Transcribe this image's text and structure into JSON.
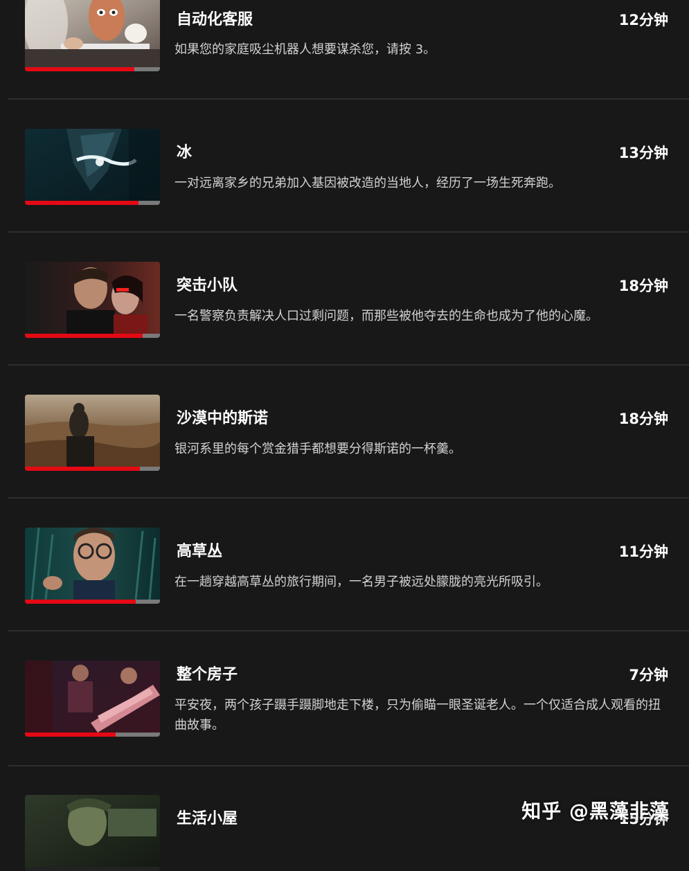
{
  "colors": {
    "background": "#181818",
    "divider": "#2e2e2e",
    "progress_accent": "#e50914",
    "progress_track": "#7a7a7a"
  },
  "episodes": [
    {
      "title": "自动化客服",
      "duration": "12分钟",
      "description": "如果您的家庭吸尘机器人想要谋杀您，请按 3。",
      "progress": 0.81
    },
    {
      "title": "冰",
      "duration": "13分钟",
      "description": "一对远离家乡的兄弟加入基因被改造的当地人，经历了一场生死奔跑。",
      "progress": 0.84
    },
    {
      "title": "突击小队",
      "duration": "18分钟",
      "description": "一名警察负责解决人口过剩问题，而那些被他夺去的生命也成为了他的心魔。",
      "progress": 0.87
    },
    {
      "title": "沙漠中的斯诺",
      "duration": "18分钟",
      "description": "银河系里的每个赏金猎手都想要分得斯诺的一杯羹。",
      "progress": 0.85
    },
    {
      "title": "高草丛",
      "duration": "11分钟",
      "description": "在一趟穿越高草丛的旅行期间，一名男子被远处朦胧的亮光所吸引。",
      "progress": 0.82
    },
    {
      "title": "整个房子",
      "duration": "7分钟",
      "description": "平安夜，两个孩子蹑手蹑脚地走下楼，只为偷瞄一眼圣诞老人。一个仅适合成人观看的扭曲故事。",
      "progress": 0.67
    },
    {
      "title": "生活小屋",
      "duration": "15分钟",
      "description": "",
      "progress": 0.0
    }
  ],
  "watermark": "知乎 @黑藻非藻"
}
